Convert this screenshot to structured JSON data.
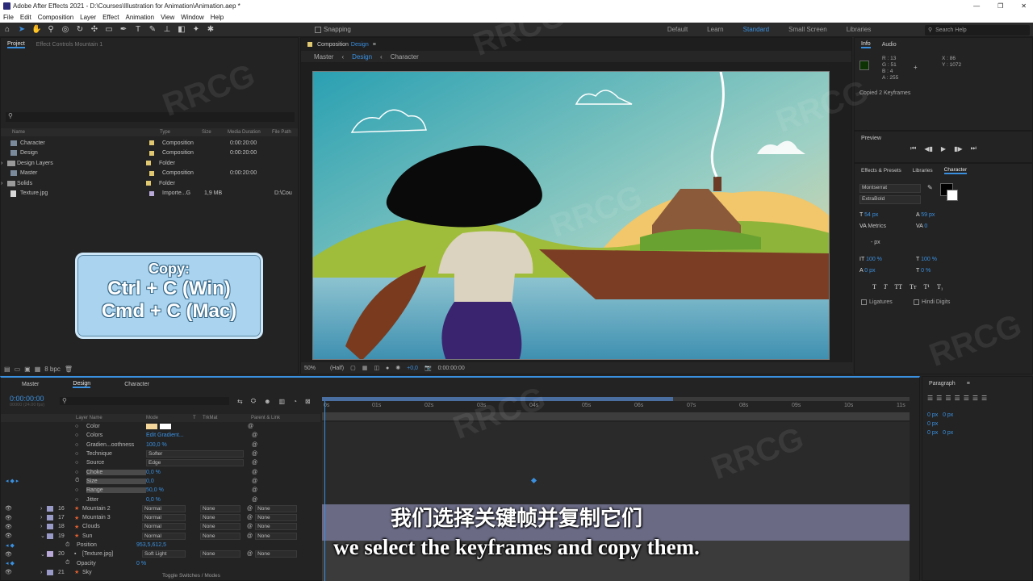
{
  "app": {
    "title": "Adobe After Effects 2021 - D:\\Courses\\Illustration for Animation\\Animation.aep *",
    "window_controls": [
      "—",
      "❐",
      "✕"
    ]
  },
  "menu": [
    "File",
    "Edit",
    "Composition",
    "Layer",
    "Effect",
    "Animation",
    "View",
    "Window",
    "Help"
  ],
  "toolbar": {
    "snapping": "Snapping",
    "workspaces": [
      "Default",
      "Learn",
      "Standard",
      "Small Screen",
      "Libraries"
    ],
    "active_workspace": "Standard",
    "search_placeholder": "Search Help"
  },
  "project": {
    "tab_project": "Project",
    "tab_effect_controls": "Effect Controls Mountain 1",
    "columns": [
      "Name",
      "Type",
      "Size",
      "Media Duration",
      "File Path"
    ],
    "rows": [
      {
        "name": "Character",
        "type": "Composition",
        "size": "",
        "duration": "0:00:20:00",
        "path": ""
      },
      {
        "name": "Design",
        "type": "Composition",
        "size": "",
        "duration": "0:00:20:00",
        "path": ""
      },
      {
        "name": "Design Layers",
        "type": "Folder",
        "size": "",
        "duration": "",
        "path": ""
      },
      {
        "name": "Master",
        "type": "Composition",
        "size": "",
        "duration": "0:00:20:00",
        "path": ""
      },
      {
        "name": "Solids",
        "type": "Folder",
        "size": "",
        "duration": "",
        "path": ""
      },
      {
        "name": "Texture.jpg",
        "type": "Importe...G",
        "size": "1,9 MB",
        "duration": "",
        "path": "D:\\Cou"
      }
    ],
    "bpc": "8 bpc"
  },
  "copy_overlay": {
    "line1": "Copy:",
    "line2": "Ctrl + C (Win)",
    "line3": "Cmd + C (Mac)"
  },
  "composition": {
    "tab": "Composition",
    "tab_name": "Design",
    "breadcrumbs": [
      "Master",
      "Design",
      "Character"
    ],
    "zoom": "50%",
    "resolution": "(Half)",
    "exposure": "+0,0",
    "timecode": "0:00:00:00"
  },
  "info": {
    "tab": "Info",
    "tab2": "Audio",
    "r": "R : 13",
    "g": "G : 51",
    "b": "B : 4",
    "a": "A : 255",
    "x": "X : 86",
    "y": "Y : 1072",
    "status": "Copied 2 Keyframes"
  },
  "preview": {
    "tab": "Preview"
  },
  "right_tabs": {
    "effects": "Effects & Presets",
    "libraries": "Libraries",
    "character": "Character"
  },
  "character": {
    "font": "Montserrat",
    "style": "ExtraBold",
    "size": "54 px",
    "leading": "59 px",
    "kerning": "Metrics",
    "tracking": "0",
    "stroke": "- px",
    "vscale": "100 %",
    "hscale": "100 %",
    "baseline": "0 px",
    "tsume": "0 %",
    "ligatures": "Ligatures",
    "hindi": "Hindi Digits"
  },
  "paragraph": {
    "tab": "Paragraph",
    "vals": [
      "0 px",
      "0 px",
      "0 px",
      "0 px",
      "0 px"
    ]
  },
  "timeline": {
    "tabs": [
      "Master",
      "Design",
      "Character"
    ],
    "active_tab": "Design",
    "timecode": "0:00:00:00",
    "fps": "00000 (24.00 fps)",
    "col_layer": "Layer Name",
    "col_mode": "Mode",
    "col_t": "T",
    "col_trkmat": "TrkMat",
    "col_parent": "Parent & Link",
    "ruler": [
      "0s",
      "01s",
      "02s",
      "03s",
      "04s",
      "05s",
      "06s",
      "07s",
      "08s",
      "09s",
      "10s",
      "11s"
    ],
    "props": [
      {
        "name": "Color",
        "value": ""
      },
      {
        "name": "Colors",
        "value": "Edit Gradient..."
      },
      {
        "name": "Gradien...oothness",
        "value": "100,0 %"
      },
      {
        "name": "Technique",
        "value": "Softer"
      },
      {
        "name": "Source",
        "value": "Edge"
      },
      {
        "name": "Choke",
        "value": "0,0 %"
      },
      {
        "name": "Size",
        "value": "0,0"
      },
      {
        "name": "Range",
        "value": "50,0 %"
      },
      {
        "name": "Jitter",
        "value": "0,0 %"
      }
    ],
    "layers": [
      {
        "num": "16",
        "name": "Mountain 2",
        "mode": "Normal",
        "trk": "None",
        "parent": "None"
      },
      {
        "num": "17",
        "name": "Mountain 3",
        "mode": "Normal",
        "trk": "None",
        "parent": "None"
      },
      {
        "num": "18",
        "name": "Clouds",
        "mode": "Normal",
        "trk": "None",
        "parent": "None"
      },
      {
        "num": "19",
        "name": "Sun",
        "mode": "Normal",
        "trk": "None",
        "parent": "None"
      }
    ],
    "position": {
      "name": "Position",
      "value": "953,5,612,5"
    },
    "texture": {
      "num": "20",
      "name": "[Texture.jpg]",
      "mode": "Soft Light",
      "trk": "None",
      "parent": "None"
    },
    "opacity": {
      "name": "Opacity",
      "value": "0 %"
    },
    "sky": {
      "num": "21",
      "name": "Sky"
    },
    "toggle": "Toggle Switches / Modes"
  },
  "subtitles": {
    "cn": "我们选择关键帧并复制它们",
    "en": "we select the keyframes and copy them."
  },
  "watermark": "RRCG"
}
